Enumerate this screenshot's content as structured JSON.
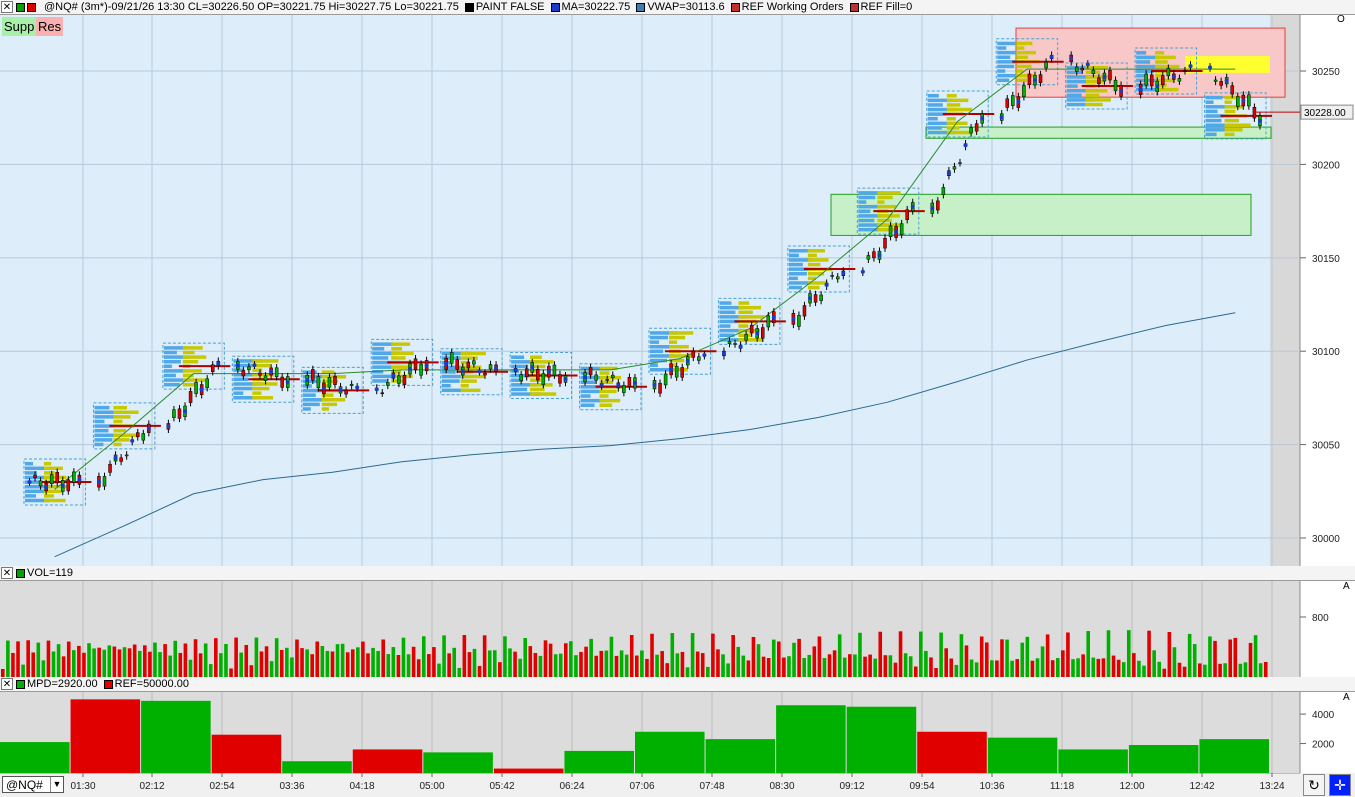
{
  "main_panel": {
    "header": {
      "symbol_info": "@NQ# (3m*)-09/21/26 13:30 CL=30226.50 OP=30221.75 Hi=30227.75 Lo=30221.75",
      "legend": [
        {
          "label": "PAINT FALSE",
          "color": "#000000"
        },
        {
          "label": "MA=30222.75",
          "color": "#1a3cc8"
        },
        {
          "label": "VWAP=30113.6",
          "color": "#3c7fb0"
        },
        {
          "label": "REF Working Orders",
          "color": "#c03030"
        },
        {
          "label": "REF Fill=0",
          "color": "#c03030"
        }
      ]
    },
    "buttons": {
      "support": "Supp",
      "resistance": "Res"
    },
    "y_ticks": [
      "30250",
      "30200",
      "30150",
      "30100",
      "30050",
      "30000"
    ],
    "last_price": "30228.00",
    "corner_label": "O"
  },
  "vol_panel": {
    "header": {
      "label": "VOL=119",
      "color": "#00a000"
    },
    "corner_label": "A",
    "y_tick": "800"
  },
  "mpd_panel": {
    "header": [
      {
        "label": "MPD=2920.00",
        "color": "#00b000"
      },
      {
        "label": "REF=50000.00",
        "color": "#e00000"
      }
    ],
    "corner_label": "A",
    "y_ticks": [
      "4000",
      "2000"
    ]
  },
  "time_axis": [
    "01:30",
    "02:12",
    "02:54",
    "03:36",
    "04:18",
    "05:00",
    "05:42",
    "06:24",
    "07:06",
    "07:48",
    "08:30",
    "09:12",
    "09:54",
    "10:36",
    "11:18",
    "12:00",
    "12:42",
    "13:24"
  ],
  "symbol_select": "@NQ#",
  "colors": {
    "chart_bg": "#ddeefa",
    "up": "#00b000",
    "down": "#e00000",
    "profile": "#c8c800"
  },
  "chart_data": [
    {
      "type": "line",
      "title": "",
      "x": [
        "01:30",
        "02:12",
        "02:54",
        "03:36",
        "04:18",
        "05:00",
        "05:42",
        "06:24",
        "07:06",
        "07:48",
        "08:30",
        "09:12",
        "09:54",
        "10:36",
        "11:18",
        "12:00",
        "12:42",
        "13:24"
      ],
      "series": [
        {
          "name": "",
          "values": [
            30030,
            30060,
            30092,
            30085,
            30079,
            30094,
            30089,
            30087,
            30081,
            30100,
            30116,
            30144,
            30175,
            30227,
            30255,
            30242,
            30250,
            30226
          ]
        }
      ],
      "ylim": [
        29985,
        30280
      ]
    },
    {
      "type": "bar",
      "title": "",
      "categories": [
        "01:30",
        "02:12",
        "02:54",
        "03:36",
        "04:18",
        "05:00",
        "05:42",
        "06:24",
        "07:06",
        "07:48",
        "08:30",
        "09:12",
        "09:54",
        "10:36",
        "11:18",
        "12:00",
        "12:42",
        "13:24"
      ],
      "values": [
        2100,
        5000,
        4900,
        2600,
        800,
        1600,
        1400,
        300,
        1500,
        2800,
        2300,
        4600,
        4500,
        2800,
        2400,
        1600,
        1900,
        2300
      ],
      "ylim": [
        0,
        5500
      ]
    }
  ]
}
